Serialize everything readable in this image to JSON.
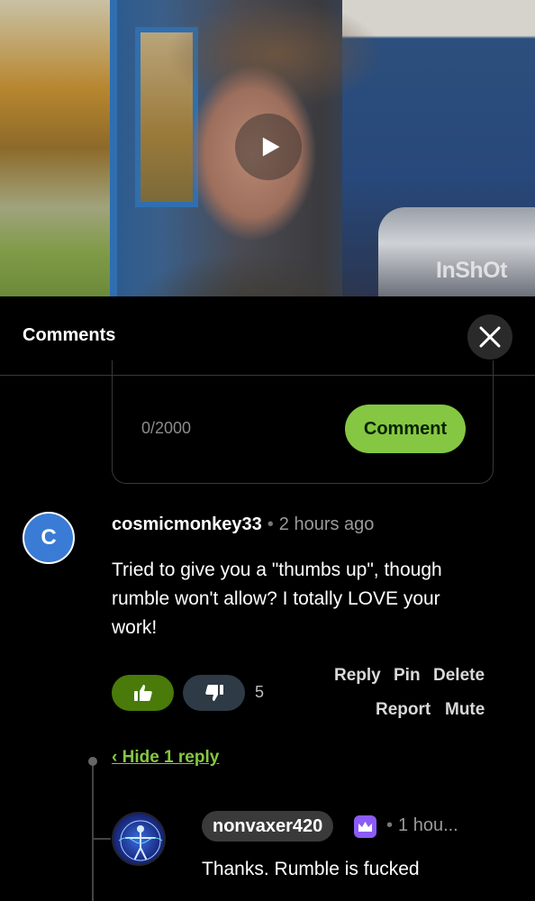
{
  "video": {
    "watermark": "InShOt",
    "play_icon": "play-icon"
  },
  "comments_panel": {
    "title": "Comments",
    "close_icon": "close-icon",
    "composer": {
      "char_count": "0/2000",
      "submit_label": "Comment"
    }
  },
  "comment": {
    "avatar_letter": "C",
    "username": "cosmicmonkey33",
    "separator": "•",
    "timestamp": "2 hours ago",
    "text": "Tried to give you a \"thumbs up\", though rumble won't allow? I totally LOVE your work!",
    "vote_count": "5",
    "actions": {
      "reply": "Reply",
      "pin": "Pin",
      "delete": "Delete",
      "report": "Report",
      "mute": "Mute"
    },
    "hide_replies": "‹ Hide 1 reply"
  },
  "reply": {
    "username": "nonvaxer420",
    "separator": "•",
    "timestamp": "1 hou...",
    "text": "Thanks. Rumble is fucked",
    "badge_icon": "crown-icon"
  },
  "colors": {
    "accent_green": "#85c742",
    "upvote_bg": "#4a7a0a",
    "downvote_bg": "#2e3a45",
    "avatar_blue": "#3a7bd5",
    "premium_purple": "#8b5cf6"
  }
}
